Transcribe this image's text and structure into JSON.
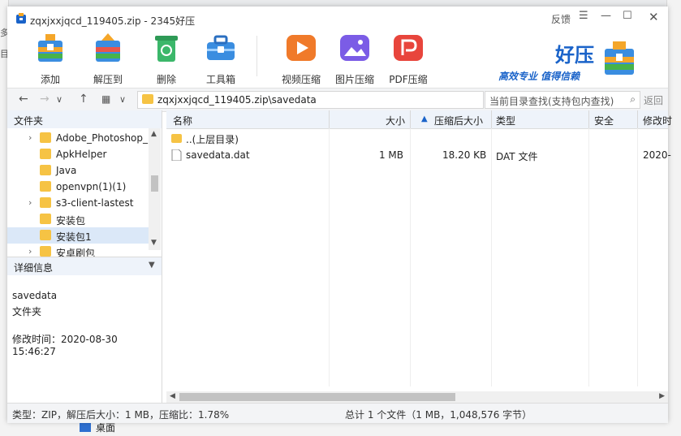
{
  "window": {
    "title": "zqxjxxjqcd_119405.zip - 2345好压",
    "feedback_label": "反馈",
    "menu_icon": "hamburger-icon",
    "minimize_icon": "minimize-icon",
    "maximize_icon": "maximize-icon",
    "close_icon": "close-icon"
  },
  "toolbar": {
    "add": "添加",
    "extract_to": "解压到",
    "delete": "删除",
    "toolbox": "工具箱",
    "video_compress": "视频压缩",
    "image_compress": "图片压缩",
    "pdf_compress": "PDF压缩"
  },
  "brand": {
    "name": "好压",
    "slogan": "高效专业 值得信赖"
  },
  "address_bar": {
    "path": "zqxjxxjqcd_119405.zip\\savedata",
    "search_placeholder": "当前目录查找(支持包内查找)",
    "restore": "返回"
  },
  "folder_tree": {
    "header": "文件夹",
    "items": [
      {
        "label": "Adobe_Photoshop_",
        "expandable": true
      },
      {
        "label": "ApkHelper",
        "expandable": false
      },
      {
        "label": "Java",
        "expandable": false
      },
      {
        "label": "openvpn(1)(1)",
        "expandable": false
      },
      {
        "label": "s3-client-lastest",
        "expandable": true
      },
      {
        "label": "安装包",
        "expandable": false
      },
      {
        "label": "安装包1",
        "expandable": false
      },
      {
        "label": "安卓刷包",
        "expandable": true
      }
    ]
  },
  "details": {
    "header": "详细信息",
    "name": "savedata",
    "type": "文件夹",
    "modified": "修改时间：2020-08-30 15:46:27"
  },
  "file_list": {
    "columns": {
      "name": "名称",
      "size": "大小",
      "compressed": "压缩后大小",
      "type": "类型",
      "security": "安全",
      "modified": "修改时"
    },
    "rows": [
      {
        "name": "..(上层目录)",
        "size": "",
        "compressed": "",
        "type": "",
        "modified": ""
      },
      {
        "name": "savedata.dat",
        "size": "1 MB",
        "compressed": "18.20 KB",
        "type": "DAT 文件",
        "modified": "2020-"
      }
    ]
  },
  "status": {
    "left": "类型：ZIP，解压后大小：1 MB，压缩比：1.78%",
    "right": "总计 1 个文件（1 MB，1,048,576 字节）"
  },
  "background": {
    "desktop_label": "桌面",
    "side_chars": [
      "多",
      "目"
    ]
  },
  "colors": {
    "accent": "#1a63c9",
    "folder": "#f6c344",
    "selection": "#dbe8f8"
  }
}
